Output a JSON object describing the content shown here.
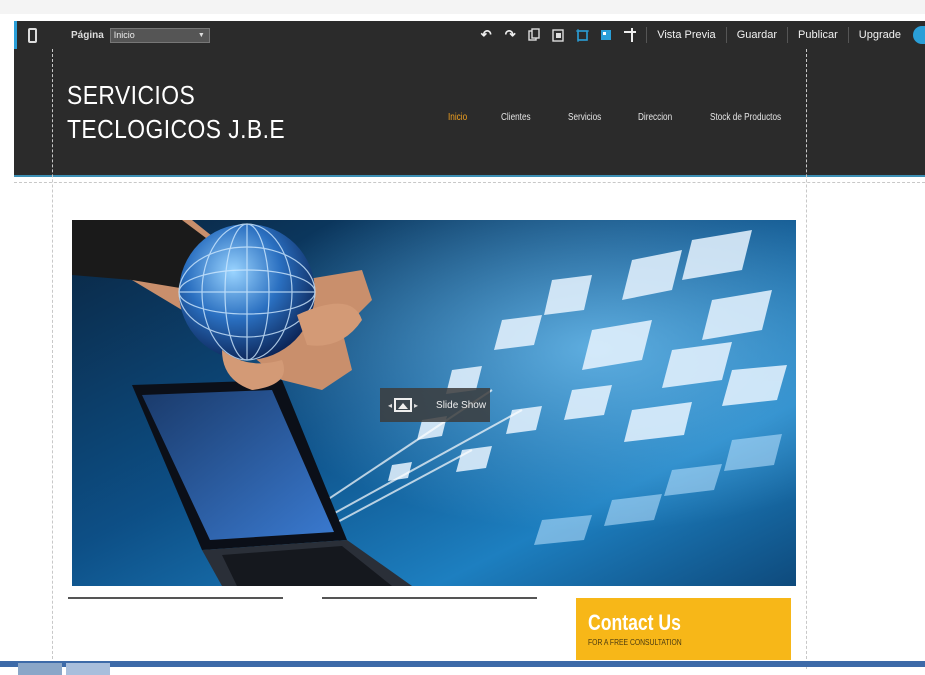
{
  "toolbar": {
    "page_label": "Página",
    "page_select_value": "Inicio",
    "icons": [
      "phone-icon",
      "undo-icon",
      "redo-icon",
      "copy-icon",
      "paste-icon",
      "grid-icon",
      "layout-icon",
      "pin-icon"
    ],
    "buttons": [
      "Vista Previa",
      "Guardar",
      "Publicar",
      "Upgrade"
    ],
    "accent_color": "#2a9fd8"
  },
  "site": {
    "title_line1": "SERVICIOS",
    "title_line2": "TECLOGICOS  J.B.E",
    "nav": [
      "Inicio",
      "Clientes",
      "Servicios",
      "Direccion",
      "Stock de Productos"
    ],
    "active_nav": "Inicio",
    "active_color": "#f0a020"
  },
  "hero": {
    "slide_label": "Slide Show"
  },
  "contact": {
    "title": "Contact Us",
    "subtitle": "FOR A FREE CONSULTATION",
    "color": "#f7b718"
  }
}
